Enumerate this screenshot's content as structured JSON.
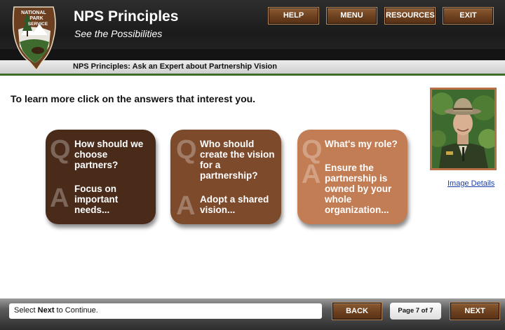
{
  "header": {
    "title": "NPS Principles",
    "subtitle": "See the Possibilities",
    "logo_text": [
      "NATIONAL",
      "PARK",
      "SERVICE"
    ],
    "buttons": {
      "help": "HELP",
      "menu": "MENU",
      "resources": "RESOURCES",
      "exit": "EXIT"
    }
  },
  "breadcrumb": "NPS Principles: Ask an Expert about Partnership Vision",
  "instructions": "To learn more click on the answers that interest you.",
  "cards": [
    {
      "q_letter": "Q",
      "a_letter": "A",
      "question": [
        "How should we",
        "choose",
        "partners?"
      ],
      "answer": [
        "Focus on",
        "important",
        "needs..."
      ],
      "color": "#4a2b1a"
    },
    {
      "q_letter": "Q",
      "a_letter": "A",
      "question": [
        "Who should",
        "create the vision",
        "for a",
        "partnership?"
      ],
      "answer": [
        "Adopt a shared",
        "vision..."
      ],
      "color": "#7d4a2c"
    },
    {
      "q_letter": "Q",
      "a_letter": "A",
      "question": [
        "What's my role?"
      ],
      "answer": [
        "Ensure the",
        "partnership is",
        "owned by your",
        "whole",
        "organization..."
      ],
      "color": "#c27d55"
    }
  ],
  "image_details_link": "Image Details",
  "footer": {
    "status_prefix": "Select ",
    "status_bold": "Next",
    "status_suffix": " to Continue.",
    "back": "BACK",
    "page": "Page 7 of 7",
    "next": "NEXT"
  },
  "colors": {
    "brown_button": "#6a3f1e",
    "accent_green": "#3c6e2a",
    "link": "#1a3fa8"
  }
}
